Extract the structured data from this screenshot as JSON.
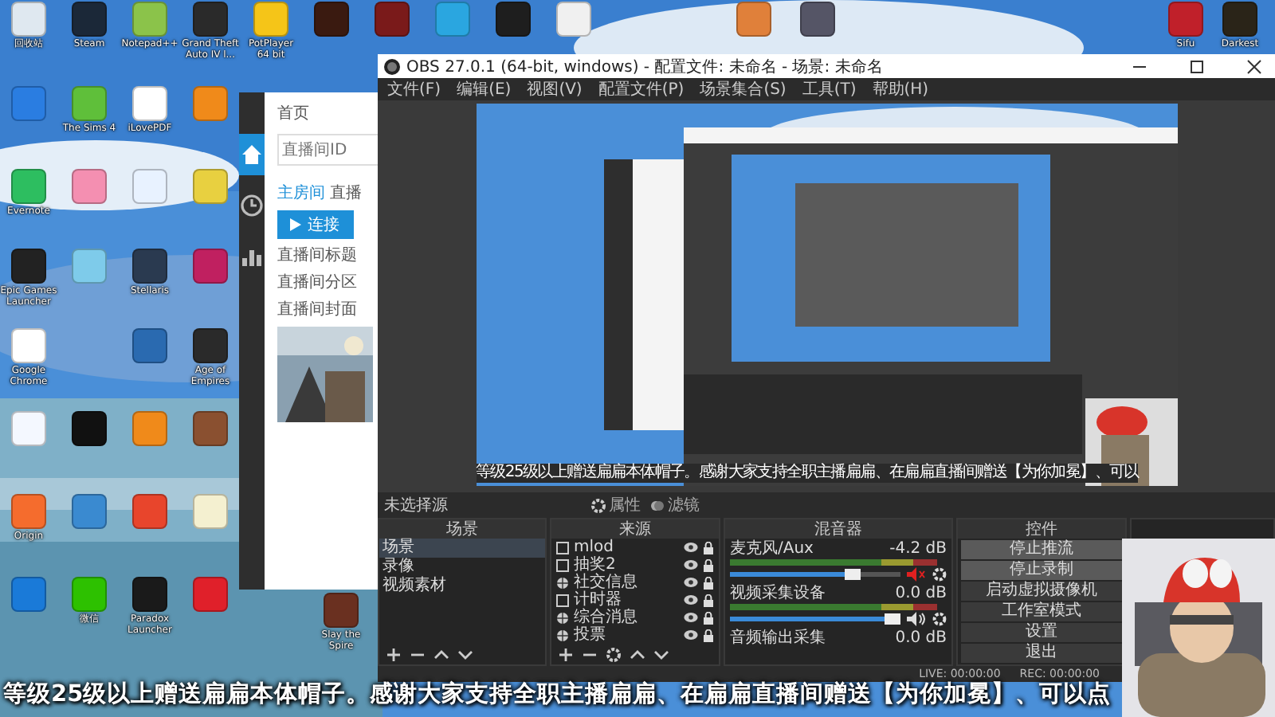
{
  "desktop_icons": [
    {
      "label": "回收站",
      "color": "#dfe8f0"
    },
    {
      "label": "Steam",
      "color": "#1b2838"
    },
    {
      "label": "Notepad++",
      "color": "#8bc34a"
    },
    {
      "label": "Grand Theft Auto IV l...",
      "color": "#2a2a2a"
    },
    {
      "label": "PotPlayer 64 bit",
      "color": "#f5c518"
    },
    {
      "color": "#3a1a10"
    },
    {
      "color": "#7a1a1a"
    },
    {
      "color": "#2aa6e0"
    },
    {
      "color": "#1e1e1e"
    },
    {
      "color": "#f0f0f0"
    },
    {
      "color": "#e0803a"
    },
    {
      "color": "#555566"
    },
    {
      "label": "Sifu",
      "color": "#c0202a"
    },
    {
      "label": "Darkest",
      "color": "#2a2418"
    },
    {
      "color": "#2a7de1"
    },
    {
      "label": "The Sims 4",
      "color": "#5fbf3a"
    },
    {
      "label": "iLovePDF",
      "color": "#ffffff"
    },
    {
      "color": "#f08a1a"
    },
    {
      "label": "Evernote",
      "color": "#2dbe60"
    },
    {
      "color": "#f48fb1"
    },
    {
      "color": "#e8f2ff"
    },
    {
      "color": "#e8d040"
    },
    {
      "label": "Epic Games Launcher",
      "color": "#222222"
    },
    {
      "color": "#7ecbea"
    },
    {
      "label": "Stellaris",
      "color": "#2a3a50"
    },
    {
      "color": "#c02060"
    },
    {
      "label": "Google Chrome",
      "color": "#ffffff"
    },
    {
      "color": "#2a6ab0"
    },
    {
      "label": "Age of Empires",
      "color": "#2a2a2a"
    },
    {
      "color": "#f4f8ff"
    },
    {
      "color": "#111111"
    },
    {
      "color": "#f08a1a"
    },
    {
      "color": "#8a5030"
    },
    {
      "label": "Origin",
      "color": "#f56c2d"
    },
    {
      "color": "#3a8ad0"
    },
    {
      "color": "#e8452c"
    },
    {
      "color": "#f4f0d0"
    },
    {
      "color": "#1a7ad8"
    },
    {
      "label": "微信",
      "color": "#2dc100"
    },
    {
      "label": "Paradox Launcher",
      "color": "#1a1a1a"
    },
    {
      "color": "#e0202a"
    },
    {
      "label": "Slay the Spire",
      "color": "#6a3020"
    }
  ],
  "side_app": {
    "nav": [
      {
        "kind": "home",
        "selected": true
      },
      {
        "kind": "clock",
        "selected": false
      },
      {
        "kind": "chart",
        "selected": false
      }
    ],
    "title": "首页",
    "id_field": {
      "placeholder": "直播间ID"
    },
    "tabs": [
      {
        "label": "主房间",
        "selected": true
      },
      {
        "label": "直播",
        "selected": false
      }
    ],
    "connect_button": "连接",
    "fields": [
      "直播间标题",
      "直播间分区",
      "直播间封面"
    ]
  },
  "obs": {
    "title": "OBS 27.0.1 (64-bit, windows) - 配置文件: 未命名 - 场景: 未命名",
    "menu": [
      "文件(F)",
      "编辑(E)",
      "视图(V)",
      "配置文件(P)",
      "场景集合(S)",
      "工具(T)",
      "帮助(H)"
    ],
    "preview_caption": "等级25级以上赠送扁扁本体帽子。感谢大家支持全职主播扁扁、在扁扁直播间赠送【为你加冕】、可以",
    "source_bar": {
      "label": "未选择源",
      "buttons": [
        {
          "kind": "gear",
          "label": "属性"
        },
        {
          "kind": "filter",
          "label": "滤镜"
        }
      ]
    },
    "scenes": {
      "title": "场景",
      "items": [
        {
          "name": "场景",
          "selected": true
        },
        {
          "name": "录像",
          "selected": false
        },
        {
          "name": "视频素材",
          "selected": false
        }
      ]
    },
    "sources": {
      "title": "来源",
      "items": [
        {
          "name": "mlod",
          "kind": "window"
        },
        {
          "name": "抽奖2",
          "kind": "window"
        },
        {
          "name": "社交信息",
          "kind": "browser"
        },
        {
          "name": "计时器",
          "kind": "window"
        },
        {
          "name": "综合消息",
          "kind": "browser"
        },
        {
          "name": "投票",
          "kind": "browser"
        }
      ]
    },
    "mixer": {
      "title": "混音器",
      "channels": [
        {
          "name": "麦克风/Aux",
          "reading": "-4.2 dB",
          "level": 0.72,
          "muted": true
        },
        {
          "name": "视频采集设备",
          "reading": "0.0 dB",
          "level": 0.95,
          "muted": false
        },
        {
          "name": "音频输出采集",
          "reading": "0.0 dB"
        }
      ]
    },
    "controls": {
      "title": "控件",
      "buttons": [
        {
          "label": "停止推流",
          "active": true
        },
        {
          "label": "停止录制",
          "active": true
        },
        {
          "label": "启动虚拟摄像机",
          "active": false
        },
        {
          "label": "工作室模式",
          "active": false
        },
        {
          "label": "设置",
          "active": false
        },
        {
          "label": "退出",
          "active": false
        }
      ]
    },
    "status": [
      "LIVE: 00:00:00",
      "REC: 00:00:00"
    ]
  },
  "subtitle": "等级25级以上赠送扁扁本体帽子。感谢大家支持全职主播扁扁、在扁扁直播间赠送【为你加冕】、可以点"
}
